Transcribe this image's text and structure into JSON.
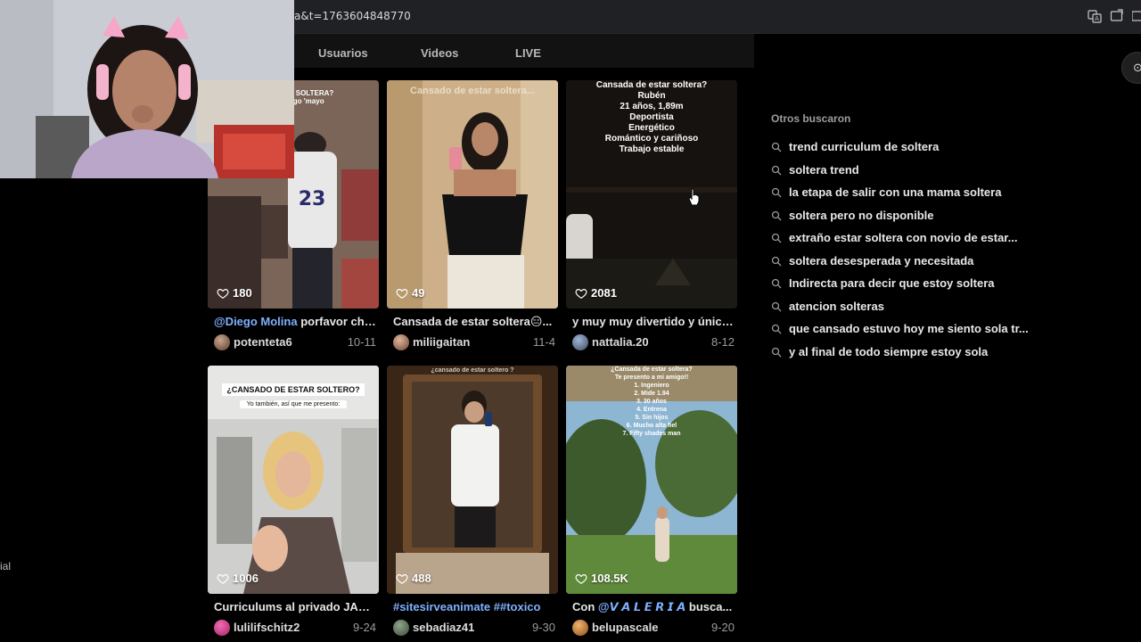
{
  "browser": {
    "url": "a&t=1763604848770",
    "icons": [
      "translate-icon",
      "install-app-icon",
      "profile-icon"
    ]
  },
  "tabs": [
    {
      "label": "Usuarios"
    },
    {
      "label": "Videos"
    },
    {
      "label": "LIVE"
    }
  ],
  "videos": [
    {
      "likes": "180",
      "caption_mention": "@Diego Molina",
      "caption_text": " porfavor chi...",
      "username": "potenteta6",
      "date": "10-11",
      "overlay": "ESTAR SOLTERA?\nun amigo 'mayo\nsoltero\nENTE"
    },
    {
      "likes": "49",
      "caption_text": "Cansada de estar soltera😑...",
      "username": "miliigaitan",
      "date": "11-4",
      "overlay": "Cansado de estar soltera..."
    },
    {
      "likes": "2081",
      "caption_text": "y muy muy divertido y único ...",
      "username": "nattalia.20",
      "date": "8-12",
      "overlay": "Cansada de estar soltera?\nRubén\n21 años, 1,89m\nDeportista\nEnergético\nRomántico y cariñoso\nTrabajo estable"
    },
    {
      "likes": "1006",
      "caption_text": "Curriculums al privado JAJA...",
      "username": "lulilifschitz2",
      "date": "9-24",
      "overlay_title": "¿CANSADO DE ESTAR SOLTERO?",
      "overlay_sub": "Yo también, así que me presento:"
    },
    {
      "likes": "488",
      "caption_hashtag": "#sitesirveanimate ##toxico",
      "username": "sebadiaz41",
      "date": "9-30",
      "overlay": "¿cansado de estar soltero ?"
    },
    {
      "likes": "108.5K",
      "caption_prefix": "Con ",
      "caption_mention": "@𝙑 𝘼 𝙇 𝙀 𝙍 𝙄 𝘼",
      "caption_text": " busca...",
      "username": "belupascale",
      "date": "9-20",
      "overlay": "¿Cansada de estar soltera?\nTe presento a mi amigo!!\n1. Ingeniero\n2. Mide 1.94\n3. 30 años\n4. Entrena\n5. Sin hijos\n6. Mucho alta fiel\n7. Fifty shades man"
    }
  ],
  "suggestions": {
    "title": "Otros buscaron",
    "items": [
      "trend curriculum de soltera",
      "soltera trend",
      "la etapa de salir con una mama soltera",
      "soltera pero no disponible",
      "extraño estar soltera con novio de estar...",
      "soltera desesperada y necesitada",
      "Indirecta para decir que estoy soltera",
      "atencion solteras",
      "que cansado estuvo hoy me siento sola tr...",
      "y al final de todo siempre estoy sola"
    ]
  },
  "edge_text": "ial",
  "colors": {
    "background": "#000000",
    "link_blue": "#7fb0ff",
    "text_muted": "#9a9a9a"
  }
}
